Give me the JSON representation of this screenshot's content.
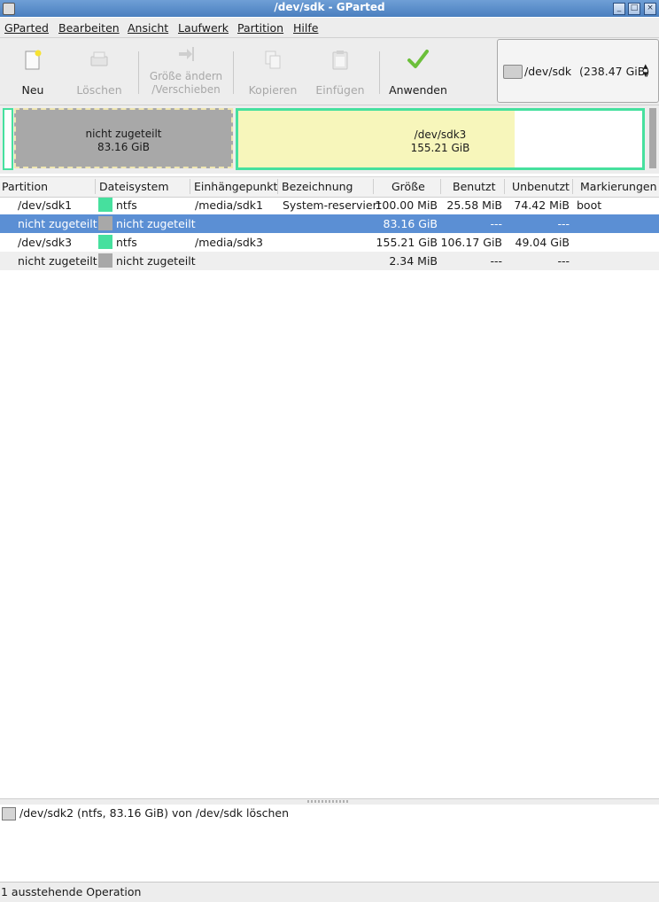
{
  "window": {
    "title": "/dev/sdk - GParted"
  },
  "menubar": {
    "items": [
      "GParted",
      "Bearbeiten",
      "Ansicht",
      "Laufwerk",
      "Partition",
      "Hilfe"
    ]
  },
  "toolbar": {
    "new": "Neu",
    "delete": "Löschen",
    "resize_line1": "Größe ändern",
    "resize_line2": "/Verschieben",
    "copy": "Kopieren",
    "paste": "Einfügen",
    "apply": "Anwenden"
  },
  "device_selector": {
    "name": "/dev/sdk",
    "size": "(238.47 GiB)"
  },
  "partition_map": {
    "unallocated": {
      "label": "nicht zugeteilt",
      "size": "83.16 GiB"
    },
    "sdk3": {
      "label": "/dev/sdk3",
      "size": "155.21 GiB",
      "used_fraction": 0.684
    },
    "colors": {
      "ntfs": "#46e09e",
      "unallocated": "#a8a8a8",
      "used": "#f7f6bb"
    }
  },
  "table": {
    "headers": [
      "Partition",
      "Dateisystem",
      "Einhängepunkt",
      "Bezeichnung",
      "Größe",
      "Benutzt",
      "Unbenutzt",
      "Markierungen"
    ],
    "rows": [
      {
        "partition": "/dev/sdk1",
        "fs": "ntfs",
        "mount": "/media/sdk1",
        "label": "System-reserviert",
        "size": "100.00 MiB",
        "used": "25.58 MiB",
        "unused": "74.42 MiB",
        "flags": "boot"
      },
      {
        "partition": "nicht zugeteilt",
        "fs": "nicht zugeteilt",
        "mount": "",
        "label": "",
        "size": "83.16 GiB",
        "used": "---",
        "unused": "---",
        "flags": ""
      },
      {
        "partition": "/dev/sdk3",
        "fs": "ntfs",
        "mount": "/media/sdk3",
        "label": "",
        "size": "155.21 GiB",
        "used": "106.17 GiB",
        "unused": "49.04 GiB",
        "flags": ""
      },
      {
        "partition": "nicht zugeteilt",
        "fs": "nicht zugeteilt",
        "mount": "",
        "label": "",
        "size": "2.34 MiB",
        "used": "---",
        "unused": "---",
        "flags": ""
      }
    ]
  },
  "operations": {
    "items": [
      "/dev/sdk2 (ntfs, 83.16 GiB) von /dev/sdk löschen"
    ]
  },
  "status": {
    "text": "1 ausstehende Operation"
  }
}
